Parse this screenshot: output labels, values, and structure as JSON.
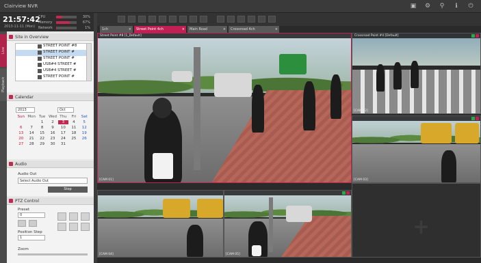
{
  "app": {
    "title": "Clairview NVR"
  },
  "status": {
    "clock": "21:57:42",
    "date": "2013-11-11 (Mon)",
    "cpu": {
      "label": "CPU",
      "percent": 30,
      "text": "30%"
    },
    "memory": {
      "label": "Memory",
      "percent": 67,
      "text": "67%"
    },
    "network": {
      "label": "Network",
      "percent": 1,
      "text": "1%"
    }
  },
  "sidetabs": {
    "live": "Live",
    "playback": "Playback"
  },
  "site": {
    "header": "Site in Overview",
    "items": [
      {
        "label": "STREET POINT #8",
        "selected": false
      },
      {
        "label": "STREET POINT #",
        "selected": true
      },
      {
        "label": "STREET POINT #",
        "selected": false
      },
      {
        "label": "USB#4 STREET #",
        "selected": false
      },
      {
        "label": "USB#4 STREET #",
        "selected": false
      },
      {
        "label": "STREET POINT #",
        "selected": false
      }
    ]
  },
  "calendar": {
    "header": "Calendar",
    "year": "2013",
    "month": "Oct",
    "days_header": [
      "Sun",
      "Mon",
      "Tue",
      "Wed",
      "Thu",
      "Fri",
      "Sat"
    ],
    "weeks": [
      [
        "",
        "",
        "1",
        "2",
        "3",
        "4",
        "5"
      ],
      [
        "6",
        "7",
        "8",
        "9",
        "10",
        "11",
        "12"
      ],
      [
        "13",
        "14",
        "15",
        "16",
        "17",
        "18",
        "19"
      ],
      [
        "20",
        "21",
        "22",
        "23",
        "24",
        "25",
        "26"
      ],
      [
        "27",
        "28",
        "29",
        "30",
        "31",
        "",
        ""
      ]
    ],
    "today": "3"
  },
  "audio": {
    "header": "Audio",
    "out_label": "Audio Out",
    "select_placeholder": "Select Audio Out",
    "button": "Stop"
  },
  "ptz": {
    "header": "PTZ Control",
    "preset_label": "Preset",
    "preset_value": "0",
    "position_step_label": "Position Step",
    "position_step_value": "1",
    "zoom_label": "Zoom"
  },
  "group_tabs": [
    {
      "label": "1ch",
      "active": false
    },
    {
      "label": "Street Point 4ch",
      "active": true
    },
    {
      "label": "Main Road",
      "active": false
    },
    {
      "label": "Crossroad 4ch",
      "active": false
    }
  ],
  "cameras": [
    {
      "title": "Street Point #8 [1_Default]",
      "footer": "[CAM 01]"
    },
    {
      "title": "Crossroad Point #4 [Default]",
      "footer": "[CAM 02]"
    },
    {
      "title": "",
      "footer": "[CAM 03]"
    },
    {
      "title": "",
      "footer": "[CAM 04]"
    },
    {
      "title": "",
      "footer": "[CAM 05]"
    }
  ],
  "colors": {
    "accent": "#c22054",
    "panel_bg": "#f3f3f3",
    "dark_bg": "#2a2a2a"
  },
  "icons": [
    "settings-icon",
    "gear-icon",
    "search-icon",
    "info-icon",
    "power-icon",
    "plus-icon"
  ]
}
